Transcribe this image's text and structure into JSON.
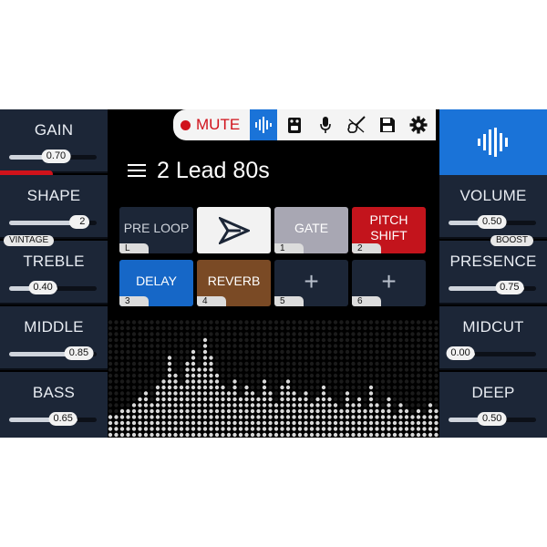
{
  "toolbar": {
    "mute_label": "MUTE",
    "icons": [
      "waveform-icon",
      "pedal-icon",
      "microphone-icon",
      "guitar-icon",
      "save-icon",
      "gear-icon"
    ]
  },
  "preset": {
    "title": "2 Lead 80s"
  },
  "left_knobs": [
    {
      "label": "GAIN",
      "value": "0.70",
      "level": 0.7
    },
    {
      "label": "SHAPE",
      "value": "2",
      "level": 0.92
    },
    {
      "label": "TREBLE",
      "value": "0.40",
      "level": 0.4
    },
    {
      "label": "MIDDLE",
      "value": "0.85",
      "level": 0.85
    },
    {
      "label": "BASS",
      "value": "0.65",
      "level": 0.65
    }
  ],
  "right_knobs": [
    {
      "label": "VOLUME",
      "value": "0.50",
      "level": 0.5
    },
    {
      "label": "PRESENCE",
      "value": "0.75",
      "level": 0.75
    },
    {
      "label": "MIDCUT",
      "value": "0.00",
      "level": 0.0
    },
    {
      "label": "DEEP",
      "value": "0.50",
      "level": 0.5
    }
  ],
  "tags": {
    "vintage": "VINTAGE",
    "boost": "BOOST"
  },
  "effects": [
    {
      "label": "PRE LOOP",
      "num": "L",
      "color": "#1c2637"
    },
    {
      "label": "",
      "num": "",
      "color": "#f2f2f2",
      "logo": true
    },
    {
      "label": "GATE",
      "num": "1",
      "color": "#a8a7b3"
    },
    {
      "label": "PITCH\nSHIFT",
      "num": "2",
      "color": "#c3141c"
    },
    {
      "label": "DELAY",
      "num": "3",
      "color": "#1667c7"
    },
    {
      "label": "REVERB",
      "num": "4",
      "color": "#7a4a25"
    },
    {
      "label": "+",
      "num": "5",
      "color": "#1c2637",
      "empty": true
    },
    {
      "label": "+",
      "num": "6",
      "color": "#1c2637",
      "empty": true
    }
  ],
  "colors": {
    "accent_blue": "#1a73d8",
    "mute_red": "#d0121b",
    "panel": "#1c2637"
  }
}
